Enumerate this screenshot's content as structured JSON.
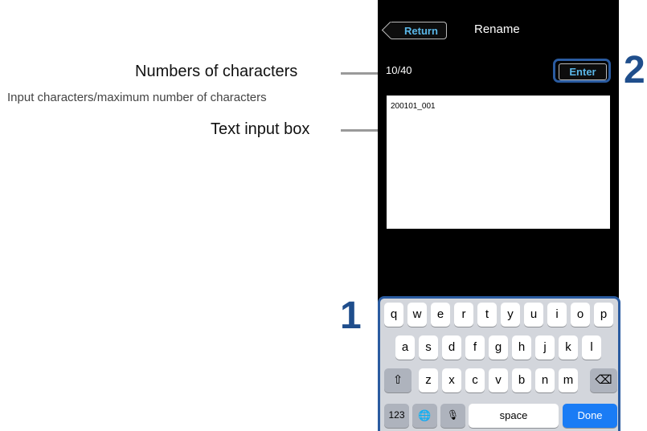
{
  "annotations": {
    "chars_label": "Numbers of characters",
    "chars_sublabel": "Input characters/maximum number of characters",
    "textbox_label": "Text input box",
    "step1": "1",
    "step2": "2"
  },
  "nav": {
    "return_label": "Return",
    "title": "Rename"
  },
  "char_count": "10/40",
  "enter_label": "Enter",
  "text_value": "200101_001",
  "keyboard": {
    "row1": [
      "q",
      "w",
      "e",
      "r",
      "t",
      "y",
      "u",
      "i",
      "o",
      "p"
    ],
    "row2": [
      "a",
      "s",
      "d",
      "f",
      "g",
      "h",
      "j",
      "k",
      "l"
    ],
    "row3": [
      "z",
      "x",
      "c",
      "v",
      "b",
      "n",
      "m"
    ],
    "shift_icon": "⇧",
    "delete_icon": "⌫",
    "numbers_label": "123",
    "globe_icon": "🌐",
    "mic_icon": "🎙",
    "space_label": "space",
    "done_label": "Done"
  }
}
